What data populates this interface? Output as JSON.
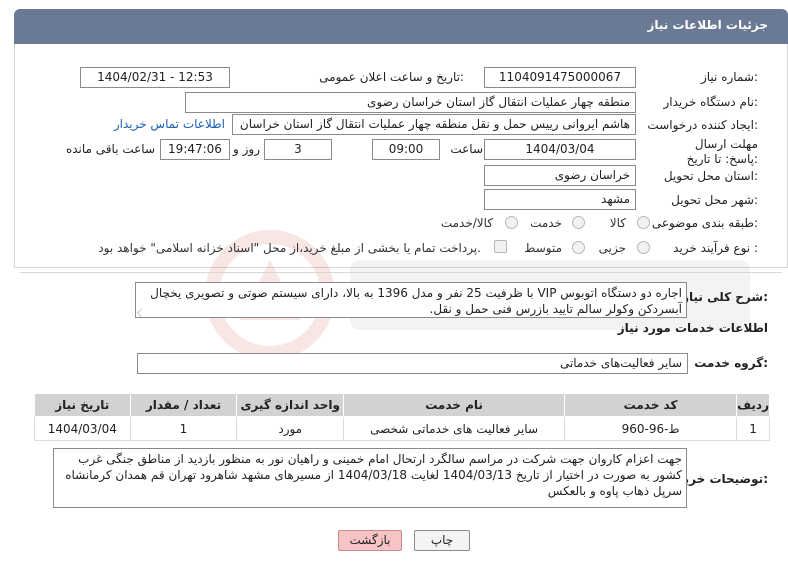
{
  "header": {
    "title": "جزئیات اطلاعات نیاز"
  },
  "fields": {
    "need_number_label": "شماره نیاز:",
    "need_number": "1104091475000067",
    "announce_label": "تاریخ و ساعت اعلان عمومی:",
    "announce_value": "1404/02/31 - 12:53",
    "buyer_label": "نام دستگاه خریدار:",
    "buyer_value": "منطقه چهار عملیات انتقال گاز   استان خراسان رضوی",
    "creator_label": "ایجاد کننده درخواست:",
    "creator_value": "هاشم ایروانی رییس حمل و نقل منطقه چهار عملیات انتقال گاز   استان خراسان",
    "contact_link": "اطلاعات تماس خریدار",
    "deadline_label": "مهلت ارسال پاسخ: تا تاریخ:",
    "deadline_date": "1404/03/04",
    "time_label": "ساعت",
    "deadline_time": "09:00",
    "days_value": "3",
    "days_label": "روز و",
    "remaining_time": "19:47:06",
    "remaining_label": "ساعت باقی مانده",
    "province_label": "استان محل تحویل:",
    "province_value": "خراسان رضوی",
    "city_label": "شهر محل تحویل:",
    "city_value": "مشهد",
    "category_label": "طبقه بندی موضوعی:",
    "category_options": [
      "کالا",
      "خدمت",
      "کالا/خدمت"
    ],
    "process_label": "نوع فرآیند خرید :",
    "process_options": [
      "جزیی",
      "متوسط"
    ],
    "payment_note": "پرداخت تمام یا بخشی از مبلغ خرید،از محل \"اسناد خزانه اسلامی\" خواهد بود."
  },
  "summary": {
    "label": "شرح کلی نیاز:",
    "text": "اجاره دو دستگاه اتوبوس VIP با ظرفیت 25 نفر و مدل 1396 به بالا، دارای سیستم صوتی و تصویری یخچال آبسردکن وکولر سالم تایید بازرس فنی حمل و نقل."
  },
  "services": {
    "section_title": "اطلاعات خدمات مورد نیاز",
    "group_label": "گروه خدمت:",
    "group_value": "سایر فعالیت‌های خدماتی",
    "columns": [
      "ردیف",
      "کد خدمت",
      "نام خدمت",
      "واحد اندازه گیری",
      "تعداد / مقدار",
      "تاریخ نیاز"
    ],
    "rows": [
      [
        "1",
        "ط-96-960",
        "سایر فعالیت های خدماتی شخصی",
        "مورد",
        "1",
        "1404/03/04"
      ]
    ]
  },
  "buyer_notes": {
    "label": "توضیحات خریدار:",
    "text": "جهت اعزام کاروان جهت شرکت در مراسم سالگرد ارتحال امام خمینی و راهیان نور به منظور بازدید از مناطق جنگی غرب کشور به صورت در اختیار از تاریخ 1404/03/13 لغایت 1404/03/18 از مسیرهای مشهد شاهرود تهران قم همدان کرمانشاه سرپل ذهاب پاوه و بالعکس"
  },
  "buttons": {
    "print": "چاپ",
    "back": "بازگشت"
  },
  "colors": {
    "header_bg": "#6b7a94",
    "back_button_bg": "#f6c4c4",
    "link": "#1a5fb4"
  }
}
